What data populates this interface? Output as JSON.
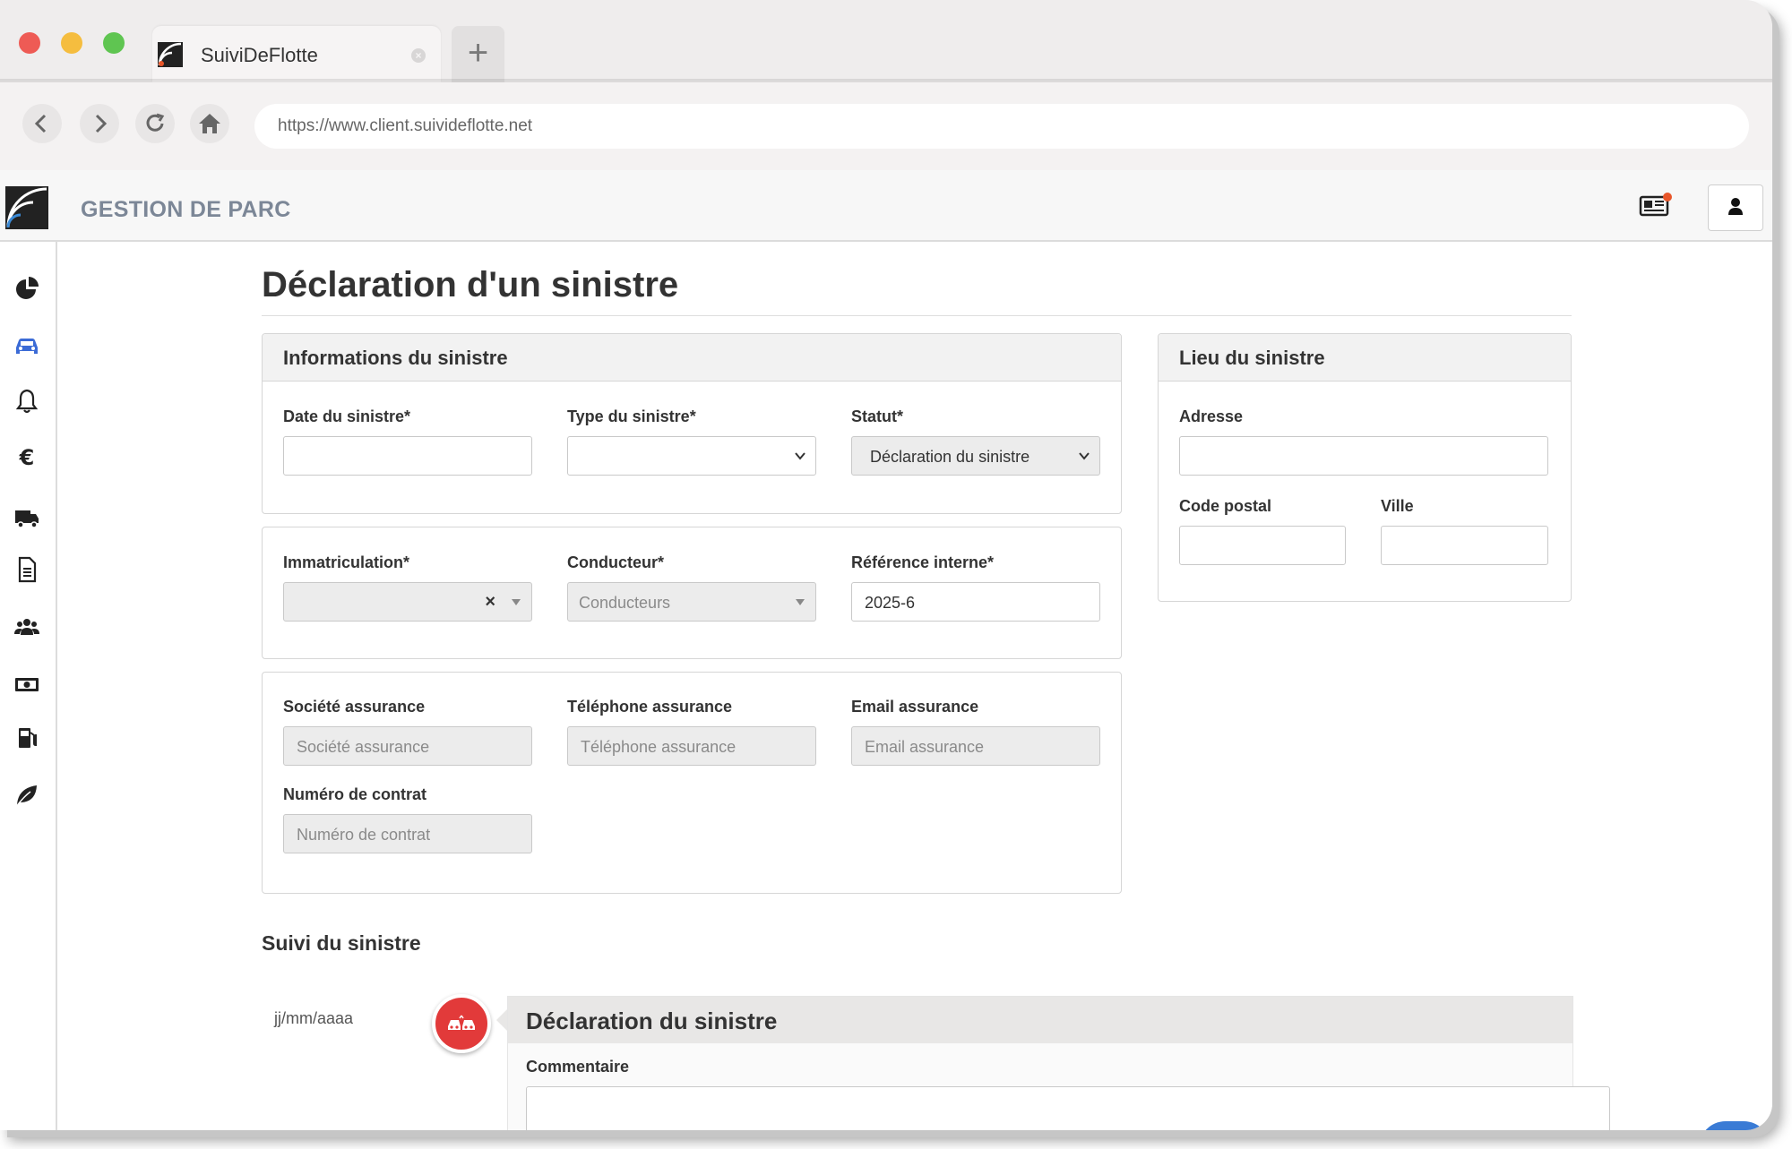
{
  "browser": {
    "tab_title": "SuiviDeFlotte",
    "new_tab_symbol": "+",
    "url": "https://www.client.suivideflotte.net",
    "window_controls": [
      "close",
      "minimize",
      "maximize"
    ],
    "colors": {
      "close": "#ee5b55",
      "minimize": "#f5bd3f",
      "maximize": "#5fc551"
    }
  },
  "app": {
    "title": "GESTION DE PARC",
    "header_icons": [
      "news-icon",
      "user-icon"
    ]
  },
  "sidebar": {
    "items": [
      {
        "icon": "pie-chart-icon",
        "active": false
      },
      {
        "icon": "car-icon",
        "active": true
      },
      {
        "icon": "bell-icon",
        "active": false
      },
      {
        "icon": "euro-icon",
        "active": false
      },
      {
        "icon": "truck-icon",
        "active": false
      },
      {
        "icon": "document-icon",
        "active": false
      },
      {
        "icon": "users-icon",
        "active": false
      },
      {
        "icon": "money-icon",
        "active": false
      },
      {
        "icon": "fuel-icon",
        "active": false
      },
      {
        "icon": "leaf-icon",
        "active": false
      }
    ],
    "active_color": "#3b6bd6"
  },
  "page": {
    "title": "Déclaration d'un sinistre"
  },
  "info_panel": {
    "title": "Informations du sinistre",
    "date_label": "Date du sinistre*",
    "type_label": "Type du sinistre*",
    "statut_label": "Statut*",
    "statut_value": "Déclaration du sinistre"
  },
  "vehicle_panel": {
    "immat_label": "Immatriculation*",
    "immat_clear": "×",
    "driver_label": "Conducteur*",
    "driver_placeholder": "Conducteurs",
    "ref_label": "Référence interne*",
    "ref_value": "2025-6"
  },
  "insurance_panel": {
    "company_label": "Société assurance",
    "company_placeholder": "Société assurance",
    "phone_label": "Téléphone assurance",
    "phone_placeholder": "Téléphone assurance",
    "email_label": "Email assurance",
    "email_placeholder": "Email assurance",
    "contract_label": "Numéro de contrat",
    "contract_placeholder": "Numéro de contrat"
  },
  "location_panel": {
    "title": "Lieu du sinistre",
    "address_label": "Adresse",
    "postal_label": "Code postal",
    "city_label": "Ville"
  },
  "tracking": {
    "title": "Suivi du sinistre",
    "entries": [
      {
        "date": "jj/mm/aaaa",
        "icon": "car-crash-icon",
        "title": "Déclaration du sinistre",
        "comment_label": "Commentaire",
        "bubble_color": "#e23a3a"
      }
    ]
  }
}
